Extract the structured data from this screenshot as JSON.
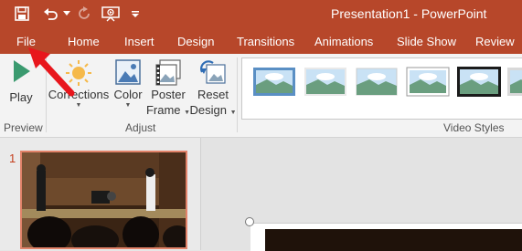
{
  "title_bar": {
    "title": "Presentation1 - PowerPoint",
    "color": "#b7472a"
  },
  "quick_access": [
    {
      "name": "save-icon"
    },
    {
      "name": "undo-icon"
    },
    {
      "name": "redo-icon"
    },
    {
      "name": "present-from-beginning-icon"
    },
    {
      "name": "customize-qat-icon"
    }
  ],
  "tabs": [
    "File",
    "Home",
    "Insert",
    "Design",
    "Transitions",
    "Animations",
    "Slide Show",
    "Review"
  ],
  "ribbon": {
    "play_label": "Play",
    "corrections_label": "Corrections",
    "color_label": "Color",
    "poster_frame_label_1": "Poster",
    "poster_frame_label_2": "Frame",
    "reset_design_label_1": "Reset",
    "reset_design_label_2": "Design",
    "groups": {
      "preview": "Preview",
      "adjust": "Adjust",
      "video_styles": "Video Styles"
    }
  },
  "slides_pane": {
    "slide_number": "1"
  },
  "annotation": {
    "arrow_color": "#e8161c"
  }
}
